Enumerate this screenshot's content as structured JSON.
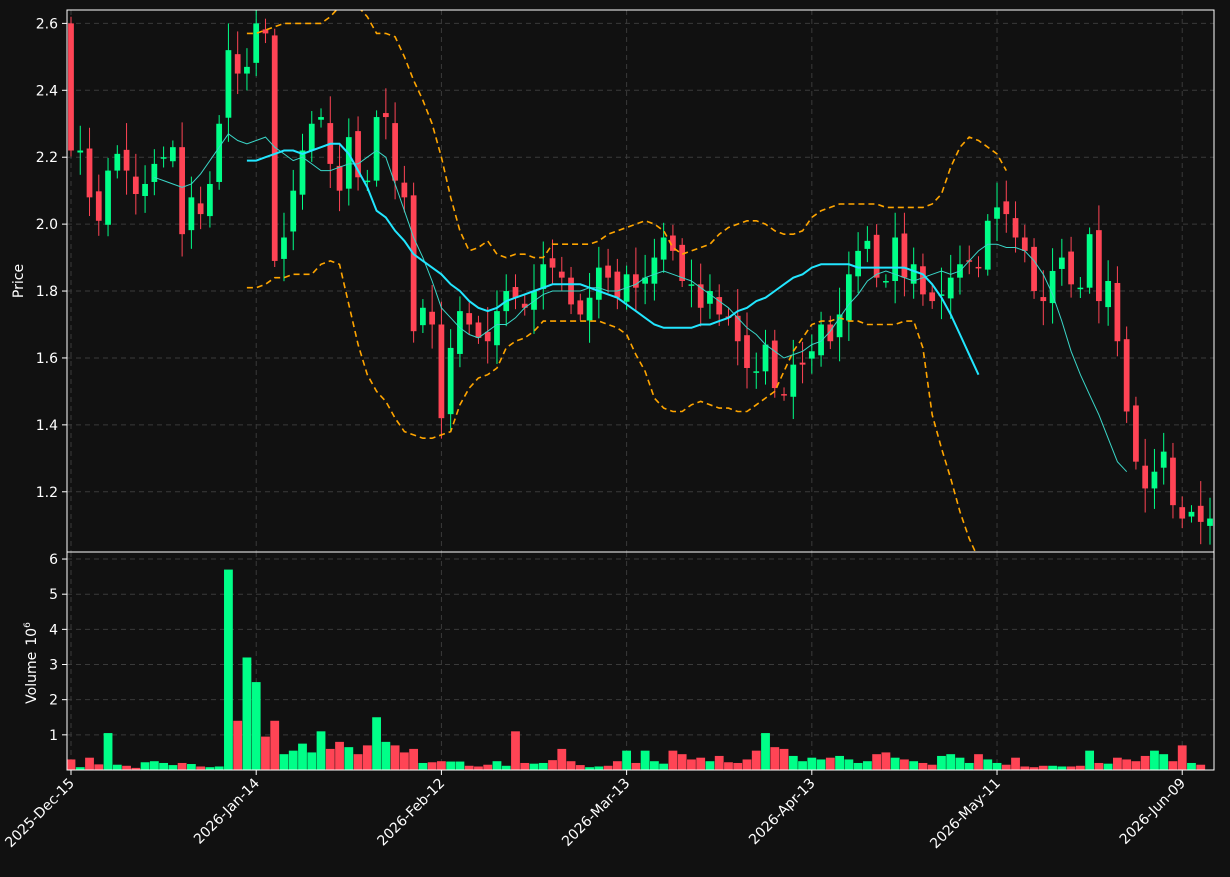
{
  "theme": {
    "background": "#111111",
    "frame": "#ffffff",
    "grid": "#3a3a3a",
    "up": "#00ff88",
    "down": "#ff4455",
    "ma_fast": "#3ad6c8",
    "ma_slow": "#22e6ff",
    "band": "#ffa500",
    "text": "#ffffff"
  },
  "chart_data": {
    "type": "candlestick",
    "price_ylabel": "Price",
    "volume_ylabel": "Volume",
    "volume_exponent_base": "10",
    "volume_exponent": "6",
    "price_ylim": [
      1.02,
      2.64
    ],
    "price_yticks": [
      "1.2",
      "1.4",
      "1.6",
      "1.8",
      "2.0",
      "2.2",
      "2.4",
      "2.6"
    ],
    "volume_ylim": [
      0,
      6.2
    ],
    "volume_yticks": [
      "1",
      "2",
      "3",
      "4",
      "5",
      "6"
    ],
    "x_tick_labels": [
      "2025-Dec-15",
      "2026-Jan-14",
      "2026-Feb-12",
      "2026-Mar-13",
      "2026-Apr-13",
      "2026-May-11",
      "2026-Jun-09"
    ],
    "x_tick_indices": [
      0,
      20,
      40,
      60,
      80,
      100,
      120
    ],
    "n_bars": 124,
    "grid": true,
    "closes": [
      2.22,
      2.22,
      2.08,
      2.01,
      2.16,
      2.21,
      2.16,
      2.09,
      2.12,
      2.18,
      2.2,
      2.23,
      1.97,
      2.08,
      2.03,
      2.12,
      2.3,
      2.52,
      2.45,
      2.47,
      2.6,
      2.57,
      1.89,
      1.96,
      2.1,
      2.22,
      2.3,
      2.32,
      2.18,
      2.1,
      2.26,
      2.14,
      2.13,
      2.32,
      2.32,
      2.13,
      2.08,
      1.68,
      1.75,
      1.7,
      1.42,
      1.63,
      1.74,
      1.7,
      1.66,
      1.65,
      1.74,
      1.8,
      1.78,
      1.75,
      1.8,
      1.88,
      1.87,
      1.84,
      1.76,
      1.73,
      1.78,
      1.87,
      1.84,
      1.78,
      1.85,
      1.81,
      1.84,
      1.9,
      1.96,
      1.92,
      1.83,
      1.82,
      1.75,
      1.8,
      1.73,
      1.72,
      1.65,
      1.57,
      1.56,
      1.64,
      1.51,
      1.49,
      1.58,
      1.58,
      1.62,
      1.7,
      1.65,
      1.73,
      1.85,
      1.92,
      1.95,
      1.84,
      1.83,
      1.96,
      1.84,
      1.88,
      1.79,
      1.77,
      1.79,
      1.84,
      1.88,
      1.89,
      1.87,
      2.01,
      2.05,
      2.03,
      1.96,
      1.92,
      1.8,
      1.77,
      1.86,
      1.9,
      1.82,
      1.81,
      1.97,
      1.77,
      1.83,
      1.65,
      1.44,
      1.29,
      1.21,
      1.26,
      1.32,
      1.16,
      1.12,
      1.14,
      1.11,
      1.12
    ],
    "ma_fast": [
      null,
      null,
      null,
      null,
      null,
      null,
      null,
      null,
      null,
      2.14,
      2.13,
      2.12,
      2.11,
      2.12,
      2.15,
      2.19,
      2.23,
      2.27,
      2.25,
      2.24,
      2.25,
      2.26,
      2.23,
      2.21,
      2.19,
      2.2,
      2.18,
      2.16,
      2.16,
      2.17,
      2.18,
      2.18,
      2.2,
      2.22,
      2.2,
      2.12,
      2.04,
      1.96,
      1.9,
      1.83,
      1.75,
      1.72,
      1.69,
      1.67,
      1.66,
      1.68,
      1.7,
      1.7,
      1.72,
      1.75,
      1.77,
      1.79,
      1.8,
      1.8,
      1.8,
      1.8,
      1.81,
      1.81,
      1.8,
      1.8,
      1.81,
      1.82,
      1.84,
      1.85,
      1.86,
      1.85,
      1.84,
      1.83,
      1.81,
      1.79,
      1.77,
      1.75,
      1.72,
      1.69,
      1.67,
      1.64,
      1.62,
      1.6,
      1.61,
      1.62,
      1.64,
      1.65,
      1.68,
      1.72,
      1.76,
      1.79,
      1.83,
      1.85,
      1.86,
      1.85,
      1.84,
      1.83,
      1.84,
      1.85,
      1.86,
      1.85,
      1.86,
      1.89,
      1.92,
      1.94,
      1.94,
      1.93,
      1.93,
      1.92,
      1.89,
      1.85,
      1.79,
      1.71,
      1.62,
      1.55,
      1.49,
      1.43,
      1.36,
      1.29,
      1.26
    ],
    "ma_slow": [
      null,
      null,
      null,
      null,
      null,
      null,
      null,
      null,
      null,
      null,
      null,
      null,
      null,
      null,
      null,
      null,
      null,
      null,
      null,
      2.19,
      2.19,
      2.2,
      2.21,
      2.22,
      2.22,
      2.21,
      2.22,
      2.23,
      2.24,
      2.24,
      2.21,
      2.16,
      2.11,
      2.04,
      2.02,
      1.98,
      1.95,
      1.91,
      1.89,
      1.87,
      1.85,
      1.82,
      1.8,
      1.77,
      1.75,
      1.74,
      1.75,
      1.77,
      1.78,
      1.79,
      1.8,
      1.81,
      1.82,
      1.82,
      1.82,
      1.82,
      1.81,
      1.8,
      1.79,
      1.78,
      1.76,
      1.74,
      1.72,
      1.7,
      1.69,
      1.69,
      1.69,
      1.69,
      1.7,
      1.7,
      1.71,
      1.72,
      1.74,
      1.75,
      1.77,
      1.78,
      1.8,
      1.82,
      1.84,
      1.85,
      1.87,
      1.88,
      1.88,
      1.88,
      1.88,
      1.87,
      1.87,
      1.87,
      1.87,
      1.87,
      1.87,
      1.86,
      1.85,
      1.82,
      1.78,
      1.73,
      1.67,
      1.61,
      1.55
    ],
    "band_upper": [
      null,
      null,
      null,
      null,
      null,
      null,
      null,
      null,
      null,
      null,
      null,
      null,
      null,
      null,
      null,
      null,
      null,
      null,
      null,
      2.57,
      2.57,
      2.58,
      2.59,
      2.6,
      2.6,
      2.6,
      2.6,
      2.6,
      2.62,
      2.65,
      2.65,
      2.65,
      2.62,
      2.57,
      2.57,
      2.56,
      2.5,
      2.43,
      2.37,
      2.3,
      2.2,
      2.08,
      1.98,
      1.92,
      1.93,
      1.95,
      1.91,
      1.9,
      1.91,
      1.91,
      1.9,
      1.9,
      1.94,
      1.94,
      1.94,
      1.94,
      1.94,
      1.95,
      1.97,
      1.98,
      1.99,
      2.0,
      2.01,
      2.0,
      1.98,
      1.93,
      1.91,
      1.92,
      1.93,
      1.94,
      1.97,
      1.99,
      2.0,
      2.01,
      2.01,
      2.0,
      1.98,
      1.97,
      1.97,
      1.98,
      2.02,
      2.04,
      2.05,
      2.06,
      2.06,
      2.06,
      2.06,
      2.06,
      2.05,
      2.05,
      2.05,
      2.05,
      2.05,
      2.06,
      2.09,
      2.17,
      2.23,
      2.26,
      2.25,
      2.23,
      2.21,
      2.16
    ],
    "band_lower": [
      null,
      null,
      null,
      null,
      null,
      null,
      null,
      null,
      null,
      null,
      null,
      null,
      null,
      null,
      null,
      null,
      null,
      null,
      null,
      1.81,
      1.81,
      1.82,
      1.84,
      1.84,
      1.85,
      1.85,
      1.85,
      1.88,
      1.89,
      1.88,
      1.76,
      1.64,
      1.55,
      1.5,
      1.47,
      1.42,
      1.38,
      1.37,
      1.36,
      1.36,
      1.37,
      1.38,
      1.46,
      1.51,
      1.54,
      1.55,
      1.57,
      1.63,
      1.65,
      1.66,
      1.68,
      1.71,
      1.71,
      1.71,
      1.71,
      1.71,
      1.71,
      1.71,
      1.7,
      1.69,
      1.67,
      1.61,
      1.56,
      1.48,
      1.45,
      1.44,
      1.44,
      1.46,
      1.47,
      1.46,
      1.45,
      1.45,
      1.44,
      1.44,
      1.46,
      1.48,
      1.5,
      1.56,
      1.62,
      1.66,
      1.7,
      1.71,
      1.71,
      1.72,
      1.71,
      1.71,
      1.7,
      1.7,
      1.7,
      1.7,
      1.71,
      1.71,
      1.63,
      1.43,
      1.33,
      1.24,
      1.14,
      1.06,
      1.0,
      0.95,
      0.92
    ],
    "volumes": [
      0.3,
      0.08,
      0.35,
      0.16,
      1.05,
      0.15,
      0.12,
      0.06,
      0.22,
      0.25,
      0.2,
      0.14,
      0.2,
      0.17,
      0.1,
      0.08,
      0.1,
      5.7,
      1.4,
      3.2,
      2.5,
      0.95,
      1.4,
      0.45,
      0.55,
      0.75,
      0.5,
      1.1,
      0.6,
      0.8,
      0.65,
      0.45,
      0.7,
      1.5,
      0.8,
      0.7,
      0.5,
      0.6,
      0.2,
      0.22,
      0.25,
      0.24,
      0.24,
      0.12,
      0.1,
      0.15,
      0.25,
      0.12,
      1.1,
      0.2,
      0.18,
      0.2,
      0.28,
      0.6,
      0.25,
      0.14,
      0.08,
      0.1,
      0.12,
      0.25,
      0.55,
      0.2,
      0.55,
      0.25,
      0.18,
      0.55,
      0.45,
      0.3,
      0.35,
      0.25,
      0.4,
      0.22,
      0.2,
      0.3,
      0.55,
      1.05,
      0.65,
      0.6,
      0.4,
      0.25,
      0.35,
      0.3,
      0.35,
      0.4,
      0.3,
      0.2,
      0.25,
      0.45,
      0.5,
      0.35,
      0.3,
      0.25,
      0.2,
      0.15,
      0.4,
      0.45,
      0.35,
      0.2,
      0.45,
      0.3,
      0.2,
      0.15,
      0.35,
      0.1,
      0.08,
      0.12,
      0.12,
      0.1,
      0.1,
      0.12,
      0.55,
      0.2,
      0.18,
      0.35,
      0.3,
      0.25,
      0.4,
      0.55,
      0.45,
      0.25,
      0.7,
      0.2,
      0.15
    ]
  }
}
